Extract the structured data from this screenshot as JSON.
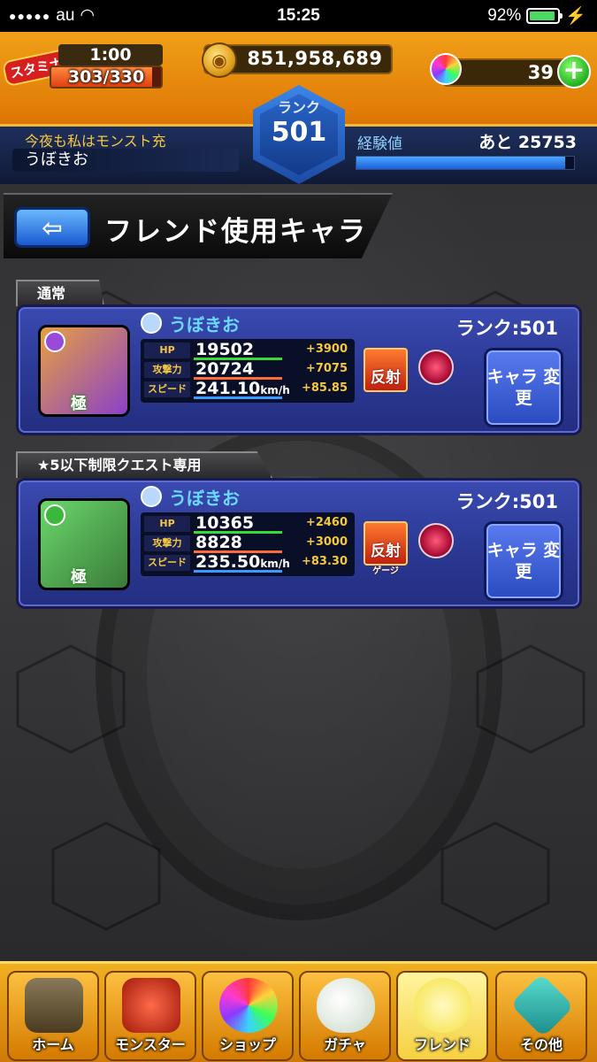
{
  "status_bar": {
    "carrier": "au",
    "time": "15:25",
    "battery": "92%",
    "battery_level": 0.92
  },
  "header": {
    "stamina_badge": "スタミナ",
    "stamina_timer": "1:00",
    "stamina_value": "303/330",
    "stamina_level": 0.918,
    "coins": "851,958,689",
    "orbs": "39",
    "rank_label": "ランク",
    "rank_value": "501",
    "player_message": "今夜も私はモンスト充",
    "player_name": "うぼきお",
    "exp_label": "経験値",
    "exp_remaining": "あと 25753",
    "exp_level": 0.96
  },
  "page": {
    "title": "フレンド使用キャラ"
  },
  "sections": [
    {
      "tab": "通常",
      "user_name": "うぼきお",
      "rank": "ランク:501",
      "hp_label": "HP",
      "hp": "19502",
      "hp_bonus": "+3900",
      "atk_label": "攻撃力",
      "atk": "20724",
      "atk_bonus": "+7075",
      "spd_label": "スピード",
      "spd": "241.10",
      "spd_unit": "km/h",
      "spd_bonus": "+85.85",
      "ability": "反射",
      "ability_sub": "",
      "kiwami": "極",
      "change_button": "キャラ 変更",
      "element_color": "#9a4ad8",
      "art_colors": [
        "#e8a040",
        "#8a40c8"
      ]
    },
    {
      "tab": "★5以下制限クエスト専用",
      "user_name": "うぼきお",
      "rank": "ランク:501",
      "hp_label": "HP",
      "hp": "10365",
      "hp_bonus": "+2460",
      "atk_label": "攻撃力",
      "atk": "8828",
      "atk_bonus": "+3000",
      "spd_label": "スピード",
      "spd": "235.50",
      "spd_unit": "km/h",
      "spd_bonus": "+83.30",
      "ability": "反射",
      "ability_sub": "ゲージ",
      "kiwami": "極",
      "change_button": "キャラ 変更",
      "element_color": "#3ab83a",
      "art_colors": [
        "#6ad86a",
        "#3a7a3a"
      ]
    }
  ],
  "bottom_nav": [
    {
      "label": "ホーム",
      "icon": "castle-gate-icon"
    },
    {
      "label": "モンスター",
      "icon": "dragon-icon"
    },
    {
      "label": "ショップ",
      "icon": "orb-icon"
    },
    {
      "label": "ガチャ",
      "icon": "egg-icon"
    },
    {
      "label": "フレンド",
      "icon": "friends-icon"
    },
    {
      "label": "その他",
      "icon": "other-icon"
    }
  ]
}
